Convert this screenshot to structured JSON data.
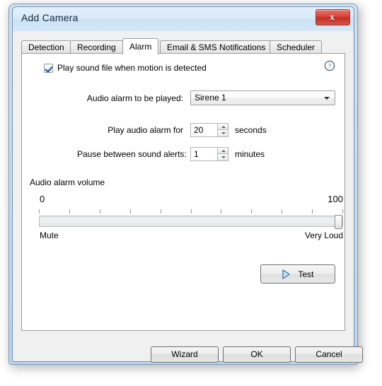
{
  "window": {
    "title": "Add Camera",
    "close_glyph": "x",
    "close_name": "Close"
  },
  "tabs": [
    {
      "label": "Detection",
      "active": false
    },
    {
      "label": "Recording",
      "active": false
    },
    {
      "label": "Alarm",
      "active": true
    },
    {
      "label": "Email & SMS Notifications",
      "active": false
    },
    {
      "label": "Scheduler",
      "active": false
    }
  ],
  "alarm_tab": {
    "enable_checkbox": {
      "label": "Play sound file when motion is detected",
      "checked": true
    },
    "help_icon": "help-circle-icon",
    "audio_alarm": {
      "label": "Audio alarm to be played:",
      "value": "Sirene 1",
      "options": [
        "Sirene 1"
      ]
    },
    "play_duration": {
      "label": "Play audio alarm for",
      "value": "20",
      "unit": "seconds"
    },
    "pause_between": {
      "label": "Pause between sound alerts:",
      "value": "1",
      "unit": "minutes"
    },
    "volume": {
      "title": "Audio alarm volume",
      "min_label": "0",
      "max_label": "100",
      "left_caption": "Mute",
      "right_caption": "Very Loud",
      "value": 100,
      "min": 0,
      "max": 100,
      "tick_count": 11
    },
    "test_button": {
      "label": "Test",
      "icon": "play-triangle-icon"
    }
  },
  "footer": {
    "wizard_label": "Wizard",
    "ok_label": "OK",
    "cancel_label": "Cancel"
  },
  "colors": {
    "accent_blue": "#4a6b8a",
    "close_red": "#c32c23",
    "frame_blue": "#cfe0f0",
    "panel_gray": "#f0f0f0"
  }
}
